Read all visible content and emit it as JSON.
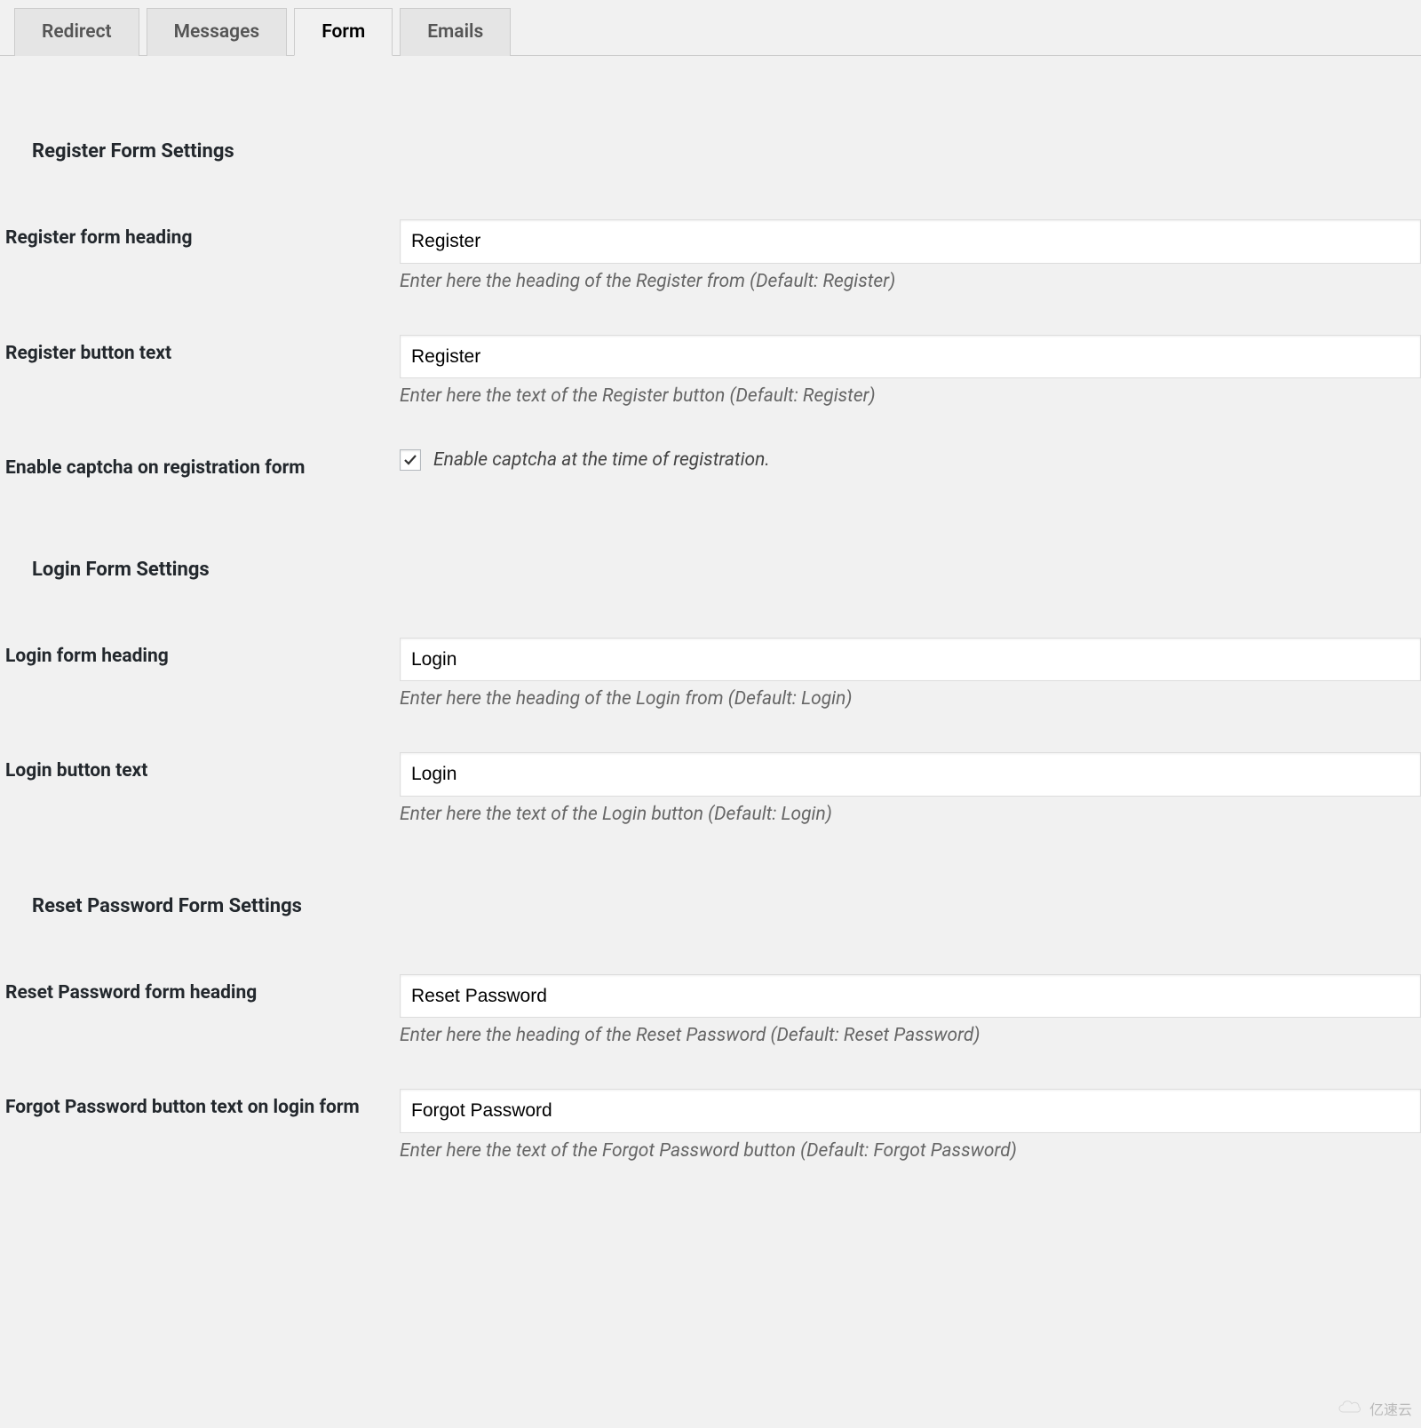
{
  "tabs": {
    "redirect": "Redirect",
    "messages": "Messages",
    "form": "Form",
    "emails": "Emails"
  },
  "sections": {
    "register": {
      "title": "Register Form Settings",
      "heading_label": "Register form heading",
      "heading_value": "Register",
      "heading_desc": "Enter here the heading of the Register from (Default: Register)",
      "button_label": "Register button text",
      "button_value": "Register",
      "button_desc": "Enter here the text of the Register button (Default: Register)",
      "captcha_label": "Enable captcha on registration form",
      "captcha_checkbox_label": "Enable captcha at the time of registration."
    },
    "login": {
      "title": "Login Form Settings",
      "heading_label": "Login form heading",
      "heading_value": "Login",
      "heading_desc": "Enter here the heading of the Login from (Default: Login)",
      "button_label": "Login button text",
      "button_value": "Login",
      "button_desc": "Enter here the text of the Login button (Default: Login)"
    },
    "reset": {
      "title": "Reset Password Form Settings",
      "heading_label": "Reset Password form heading",
      "heading_value": "Reset Password",
      "heading_desc": "Enter here the heading of the Reset Password (Default: Reset Password)",
      "button_label": "Forgot Password button text on login form",
      "button_value": "Forgot Password",
      "button_desc": "Enter here the text of the Forgot Password button (Default: Forgot Password)"
    }
  },
  "watermark": "亿速云"
}
